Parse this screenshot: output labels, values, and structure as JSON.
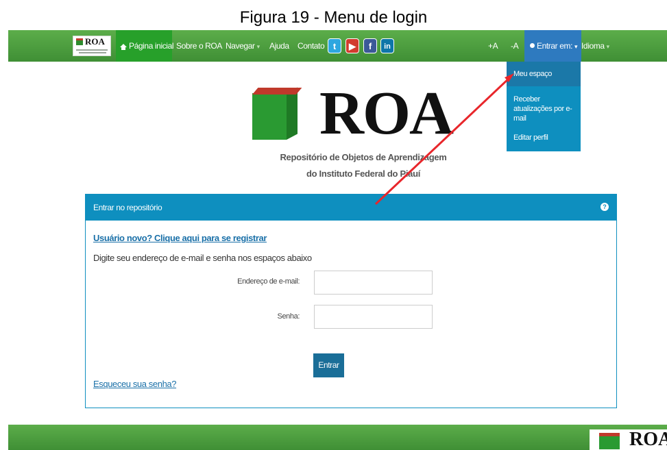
{
  "figure_caption": "Figura 19 - Menu de login",
  "navbar": {
    "logo_text": "ROA",
    "home_label": "Página inicial",
    "about_label": "Sobre o ROA",
    "browse_label": "Navegar",
    "help_label": "Ajuda",
    "contact_label": "Contato",
    "social": [
      "twitter-icon",
      "youtube-icon",
      "facebook-icon",
      "linkedin-icon"
    ],
    "font_increase_label": "+A",
    "font_decrease_label": "-A",
    "login_label": "Entrar em:",
    "language_label": "Idioma",
    "colors": {
      "bar": "#4a9e3e",
      "home_bg": "#27a02a",
      "login_bg": "#2e7abf"
    }
  },
  "dropdown": {
    "items": [
      {
        "label": "Meu espaço"
      },
      {
        "label": "Receber atualizações por e-mail"
      },
      {
        "label": "Editar perfil"
      }
    ]
  },
  "brand": {
    "title": "ROA",
    "tagline_line1": "Repositório de Objetos de Aprendizagem",
    "tagline_line2": "do Instituto Federal do Piauí"
  },
  "login_panel": {
    "title": "Entrar no repositório",
    "register_link": "Usuário novo? Clique aqui para se registrar",
    "instructions": "Digite seu endereço de e-mail e senha nos espaços abaixo",
    "email_label": "Endereço de e-mail:",
    "email_value": "",
    "password_label": "Senha:",
    "password_value": "",
    "submit_label": "Entrar",
    "forgot_link": "Esqueceu sua senha?",
    "accent_color": "#0e8fbf"
  },
  "footer": {
    "logo_text": "ROA"
  }
}
